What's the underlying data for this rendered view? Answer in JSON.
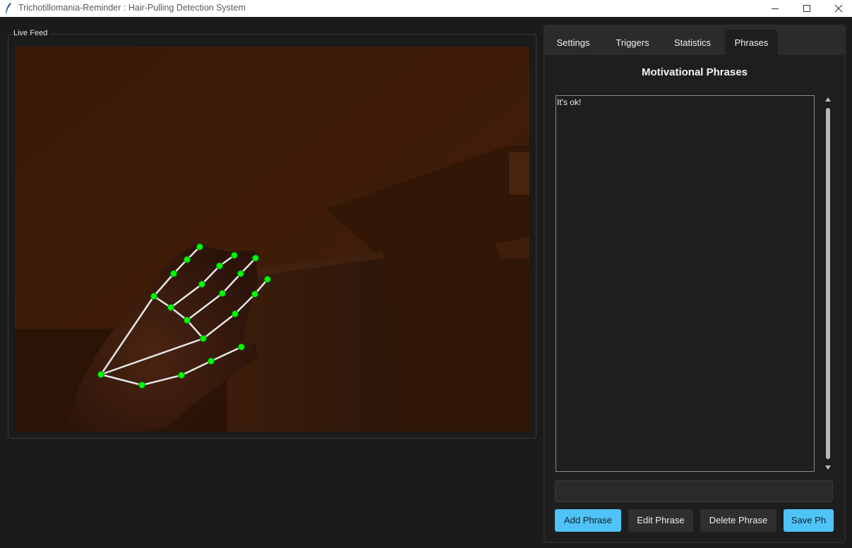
{
  "window": {
    "title": "Trichotillomania-Reminder : Hair-Pulling Detection System",
    "controls": [
      "minimize-icon",
      "maximize-icon",
      "close-icon"
    ]
  },
  "live_feed": {
    "label": "Live Feed",
    "overlay_color": "#00ff00",
    "skeleton_color": "#e6e6e6"
  },
  "tabs": [
    {
      "label": "Settings",
      "active": false
    },
    {
      "label": "Triggers",
      "active": false
    },
    {
      "label": "Statistics",
      "active": false
    },
    {
      "label": "Phrases",
      "active": true
    }
  ],
  "phrases": {
    "title": "Motivational Phrases",
    "list_text": "It's ok!",
    "input_value": "",
    "buttons": {
      "add": "Add Phrase",
      "edit": "Edit Phrase",
      "delete": "Delete Phrase",
      "save": "Save Ph"
    }
  },
  "colors": {
    "accent": "#4fc3f7",
    "background": "#1b1b1b",
    "panel": "#1e1e1e"
  }
}
